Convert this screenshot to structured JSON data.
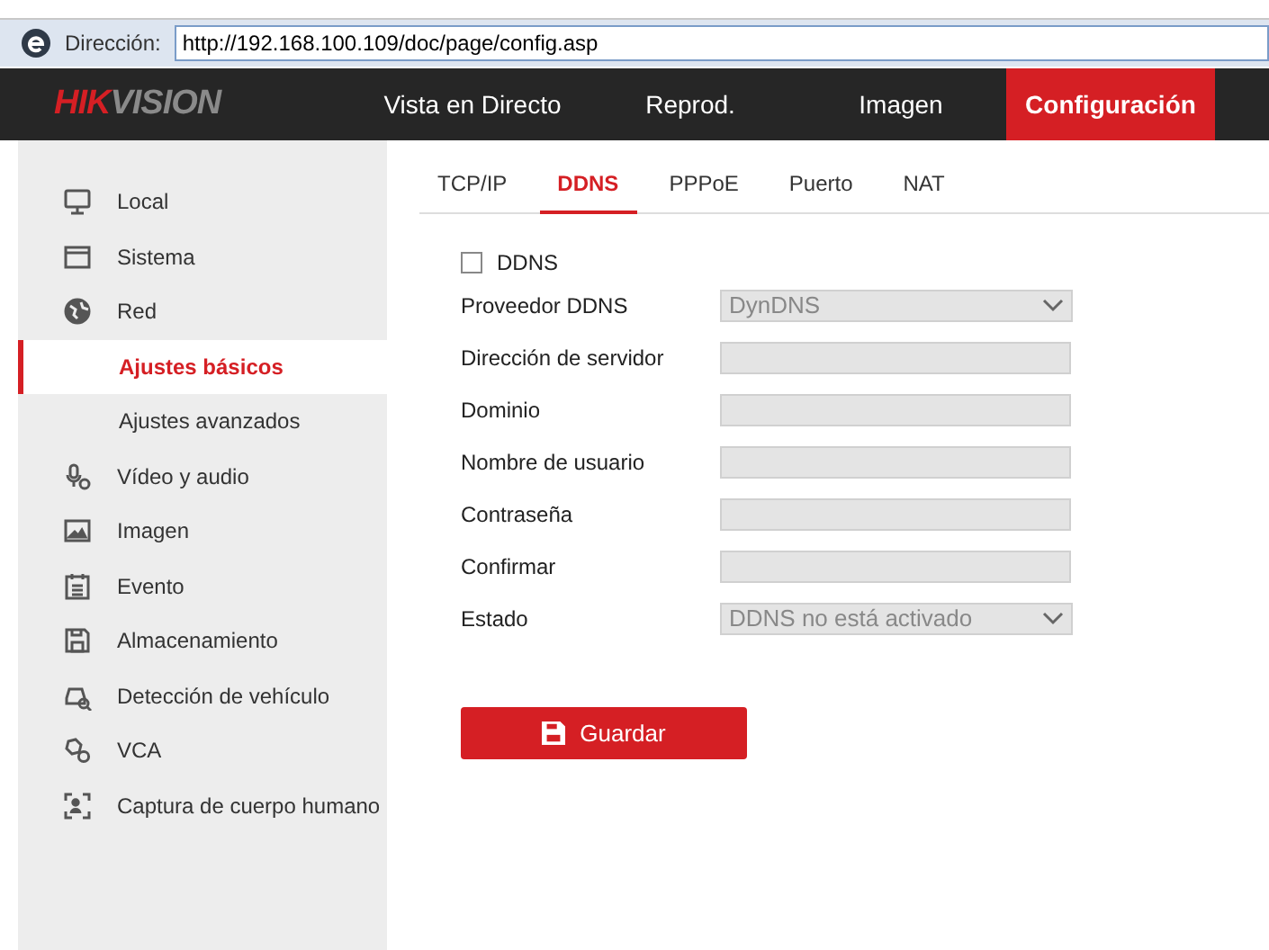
{
  "browser": {
    "address_label": "Dirección:",
    "url": "http://192.168.100.109/doc/page/config.asp"
  },
  "logo": {
    "part_1": "HIK",
    "part_2": "VISION"
  },
  "nav": [
    {
      "label": "Vista en Directo",
      "selected": false
    },
    {
      "label": "Reprod.",
      "selected": false
    },
    {
      "label": "Imagen",
      "selected": false
    },
    {
      "label": "Configuración",
      "selected": true
    }
  ],
  "sidebar": [
    {
      "label": "Local",
      "selected": false
    },
    {
      "label": "Sistema",
      "selected": false
    },
    {
      "label": "Red",
      "selected": false,
      "children": [
        {
          "label": "Ajustes básicos",
          "selected": true
        },
        {
          "label": "Ajustes avanzados",
          "selected": false
        }
      ]
    },
    {
      "label": "Vídeo y audio",
      "selected": false
    },
    {
      "label": "Imagen",
      "selected": false
    },
    {
      "label": "Evento",
      "selected": false
    },
    {
      "label": "Almacenamiento",
      "selected": false
    },
    {
      "label": "Detección de vehículo",
      "selected": false
    },
    {
      "label": "VCA",
      "selected": false
    },
    {
      "label": "Captura de cuerpo humano",
      "selected": false
    }
  ],
  "tabs": [
    {
      "label": "TCP/IP",
      "selected": false
    },
    {
      "label": "DDNS",
      "selected": true
    },
    {
      "label": "PPPoE",
      "selected": false
    },
    {
      "label": "Puerto",
      "selected": false
    },
    {
      "label": "NAT",
      "selected": false
    }
  ],
  "enable": {
    "label": "DDNS",
    "checked": false
  },
  "fields": [
    {
      "kind": "select",
      "label": "Proveedor DDNS",
      "value": "DynDNS",
      "disabled": true
    },
    {
      "kind": "text",
      "label": "Dirección de servidor",
      "disabled": true
    },
    {
      "kind": "text",
      "label": "Dominio",
      "disabled": true
    },
    {
      "kind": "text",
      "label": "Nombre de usuario",
      "disabled": true
    },
    {
      "kind": "text",
      "label": "Contraseña",
      "disabled": true
    },
    {
      "kind": "text",
      "label": "Confirmar",
      "disabled": true
    },
    {
      "kind": "select",
      "label": "Estado",
      "value": "DDNS no está activado",
      "disabled": true
    }
  ],
  "save_button": "Guardar"
}
